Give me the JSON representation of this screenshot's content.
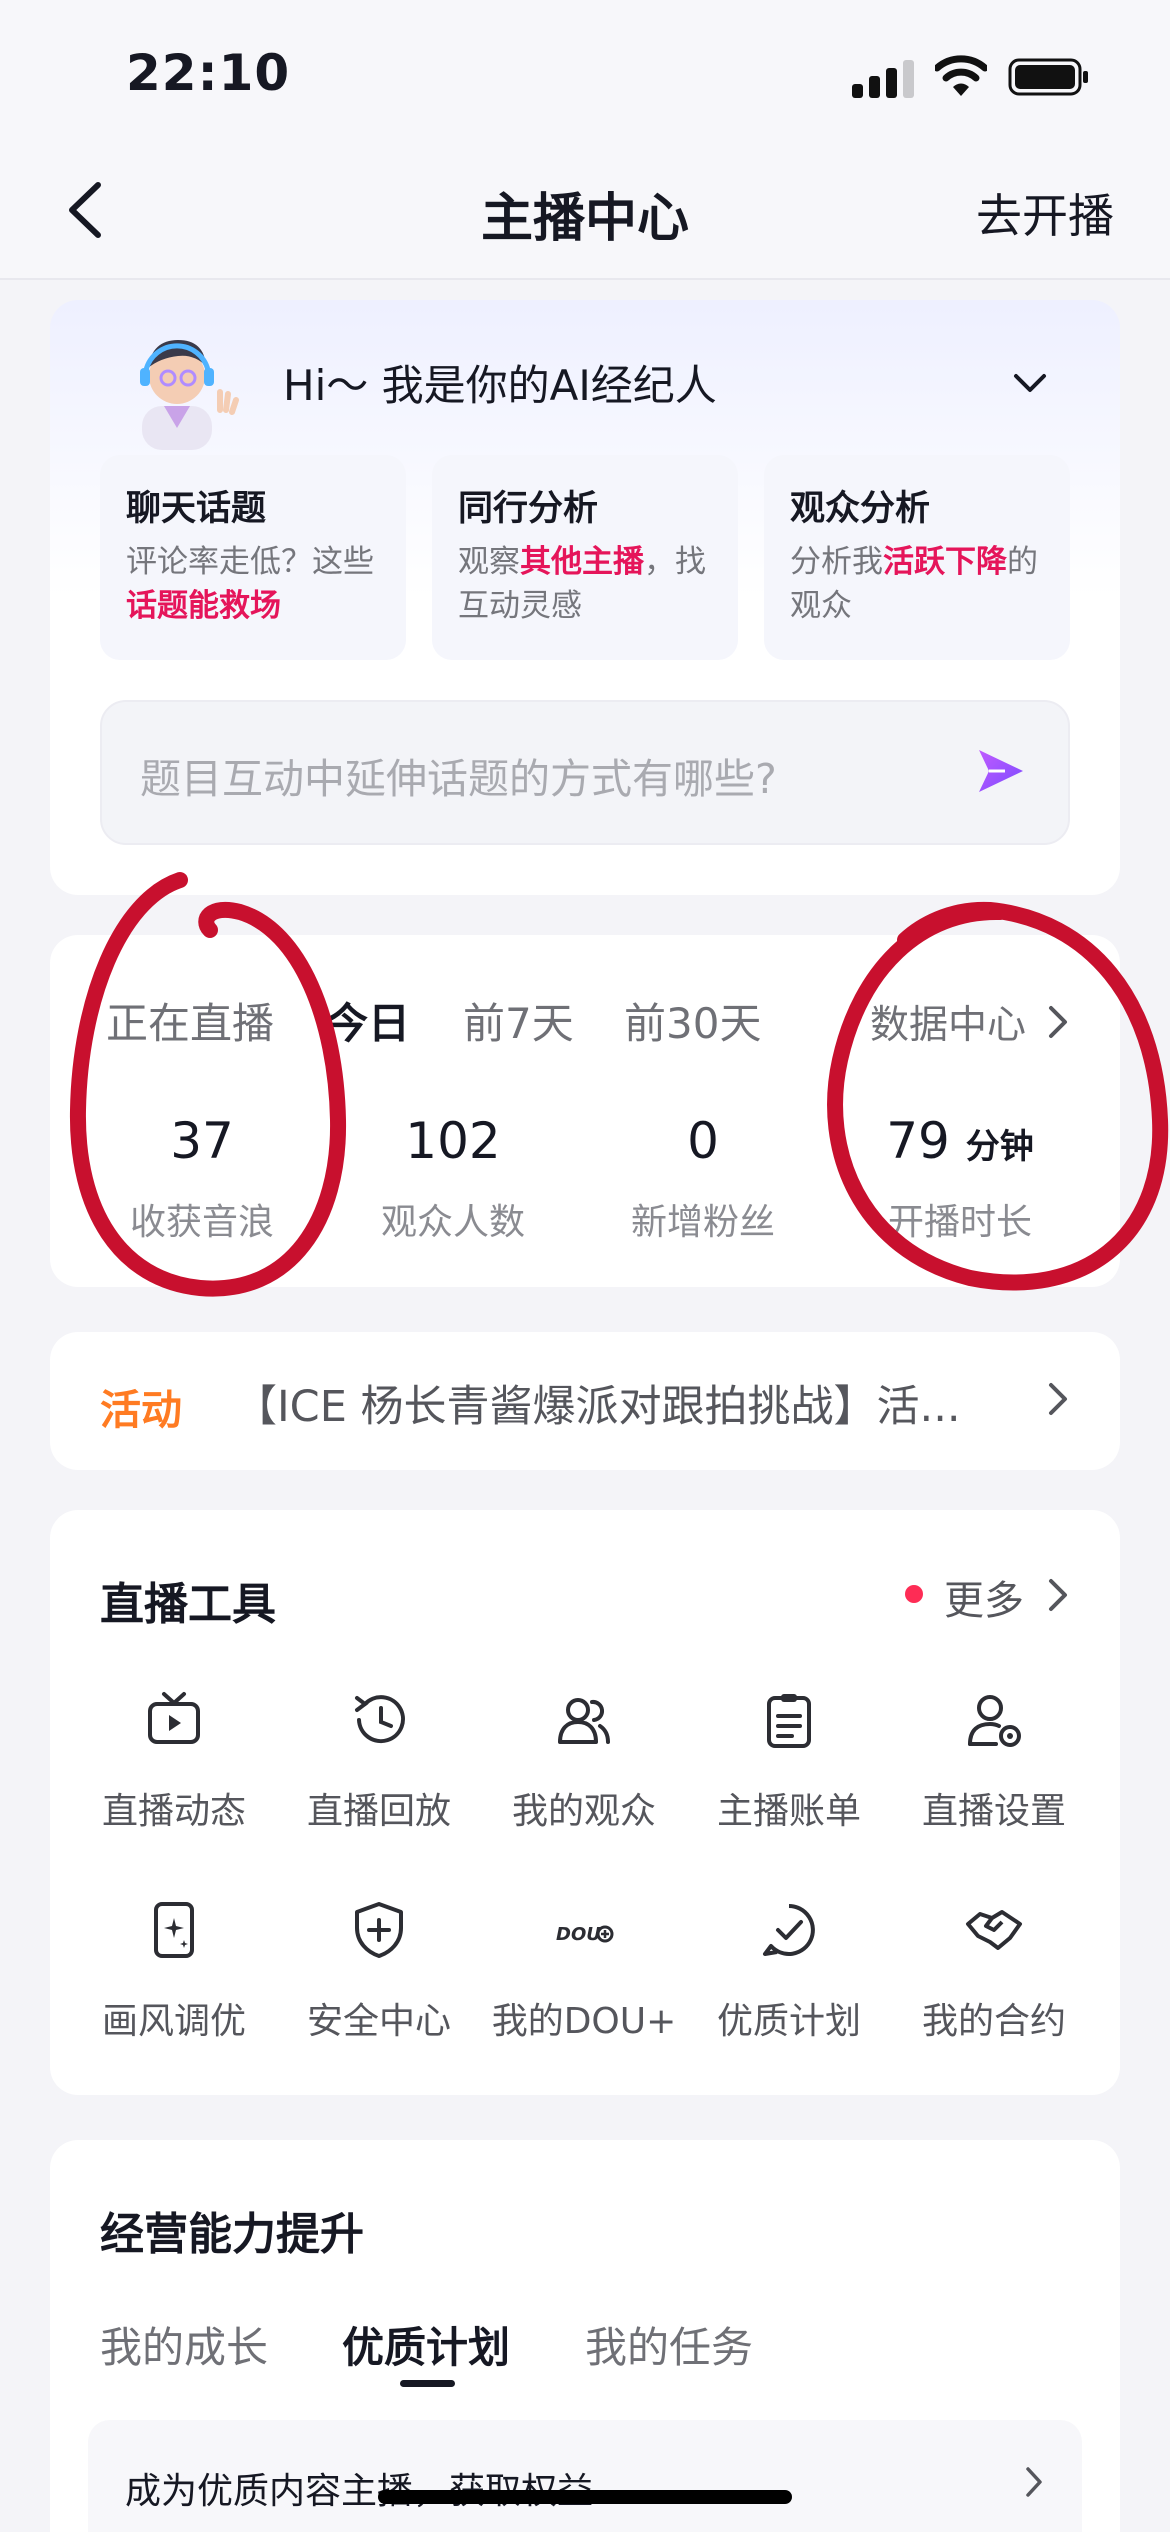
{
  "status_bar": {
    "time": "22:10"
  },
  "nav": {
    "title": "主播中心",
    "action": "去开播"
  },
  "ai_assistant": {
    "greeting": "Hi～ 我是你的AI经纪人",
    "cards": [
      {
        "title": "聊天话题",
        "desc_a": "评论率走低？这些",
        "highlight": "话题能救场",
        "desc_b": ""
      },
      {
        "title": "同行分析",
        "desc_a": "观察",
        "highlight": "其他主播",
        "desc_b": "，找互动灵感"
      },
      {
        "title": "观众分析",
        "desc_a": "分析我",
        "highlight": "活跃下降",
        "desc_b": "的观众"
      }
    ],
    "ask_placeholder": "题目互动中延伸话题的方式有哪些?"
  },
  "stats": {
    "tabs": [
      "正在直播",
      "今日",
      "前7天",
      "前30天"
    ],
    "active_tab": "今日",
    "data_center": "数据中心",
    "items": [
      {
        "value": "37",
        "unit": "",
        "label": "收获音浪"
      },
      {
        "value": "102",
        "unit": "",
        "label": "观众人数"
      },
      {
        "value": "0",
        "unit": "",
        "label": "新增粉丝"
      },
      {
        "value": "79",
        "unit": "分钟",
        "label": "开播时长"
      }
    ]
  },
  "activity": {
    "tag": "活动",
    "text": "【ICE 杨长青酱爆派对跟拍挑战】活..."
  },
  "tools": {
    "title": "直播工具",
    "more": "更多",
    "items": [
      {
        "label": "直播动态",
        "icon": "tv-play-icon"
      },
      {
        "label": "直播回放",
        "icon": "history-clock-icon"
      },
      {
        "label": "我的观众",
        "icon": "users-icon"
      },
      {
        "label": "主播账单",
        "icon": "bill-icon"
      },
      {
        "label": "直播设置",
        "icon": "user-settings-icon"
      },
      {
        "label": "画风调优",
        "icon": "sparkle-phone-icon"
      },
      {
        "label": "安全中心",
        "icon": "shield-icon"
      },
      {
        "label": "我的DOU+",
        "icon": "dou-plus-icon"
      },
      {
        "label": "优质计划",
        "icon": "check-circle-icon"
      },
      {
        "label": "我的合约",
        "icon": "handshake-icon"
      }
    ]
  },
  "growth": {
    "title": "经营能力提升",
    "tabs": [
      "我的成长",
      "优质计划",
      "我的任务"
    ],
    "active_tab": "优质计划",
    "item_text": "成为优质内容主播，获取权益"
  },
  "colors": {
    "accent_red": "#fe2c55",
    "highlight": "#e5155a",
    "activity_orange": "#ff7b22",
    "send_purple": "#a24bff",
    "annotation_red": "#c8102e"
  }
}
